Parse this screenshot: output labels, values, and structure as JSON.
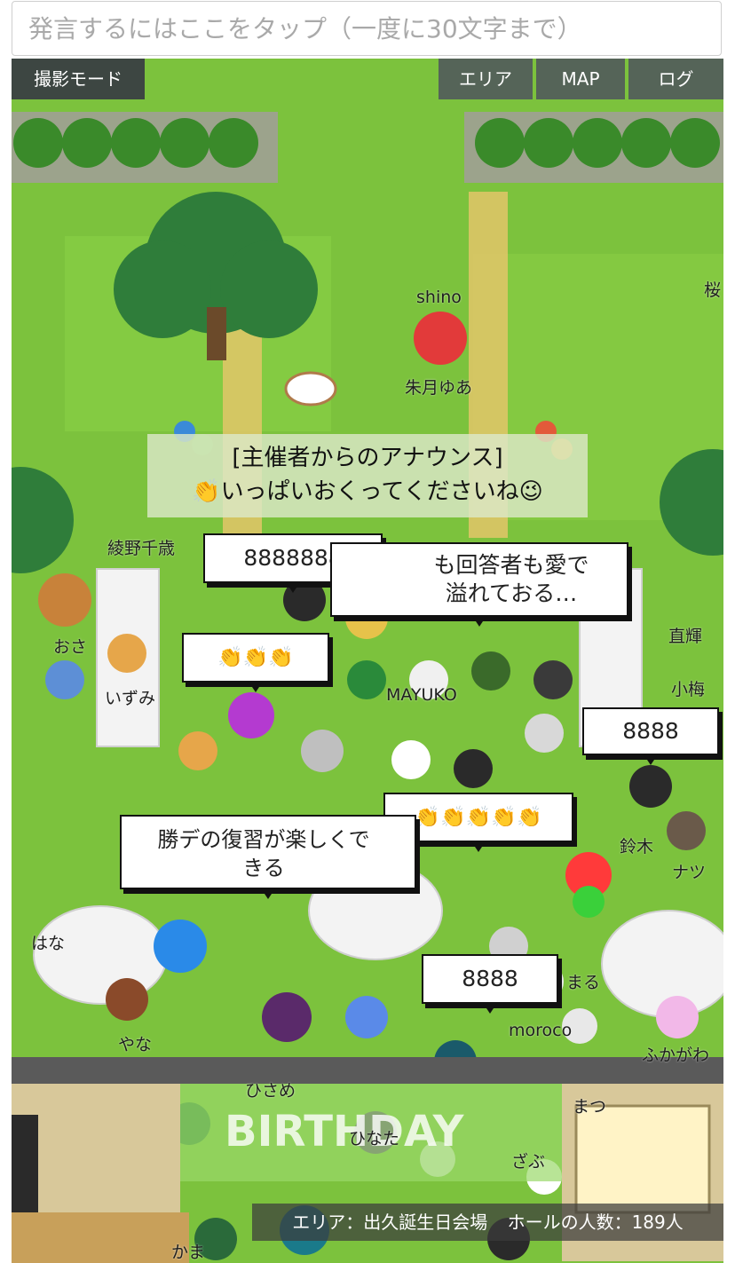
{
  "chat": {
    "placeholder": "発言するにはここをタップ（一度に30文字まで）"
  },
  "toolbar": {
    "photo_mode": "撮影モード",
    "area": "エリア",
    "map": "MAP",
    "log": "ログ"
  },
  "announcement": {
    "title": "[主催者からのアナウンス]",
    "message": "👏いっぱいおくってくださいね😉"
  },
  "bubbles": [
    {
      "text": "8888888"
    },
    {
      "text": "も回答者も愛で溢れておる…"
    },
    {
      "text": "👏👏👏"
    },
    {
      "text": "8888"
    },
    {
      "text": "👏👏👏👏👏"
    },
    {
      "text": "勝デの復習が楽しくできる"
    },
    {
      "text": "8888"
    }
  ],
  "players": [
    "shino",
    "朱月ゆあ",
    "綾野千歳",
    "桜",
    "おさ",
    "いずみ",
    "直輝",
    "小梅",
    "鈴木",
    "ナツ",
    "MAYUKO",
    "まる",
    "moroco",
    "はな",
    "やな",
    "ひさめ",
    "ひなた",
    "まつ",
    "ふかがわ",
    "ざぶ",
    "かま"
  ],
  "status_bar": {
    "area": "エリア：出久誕生日会場",
    "count": "ホールの人数：189人"
  },
  "colors": {
    "grass": "#7cc23d",
    "button_bg": "#50565c",
    "hedge": "#3a8a2a",
    "tree": "#2f7d3a"
  }
}
